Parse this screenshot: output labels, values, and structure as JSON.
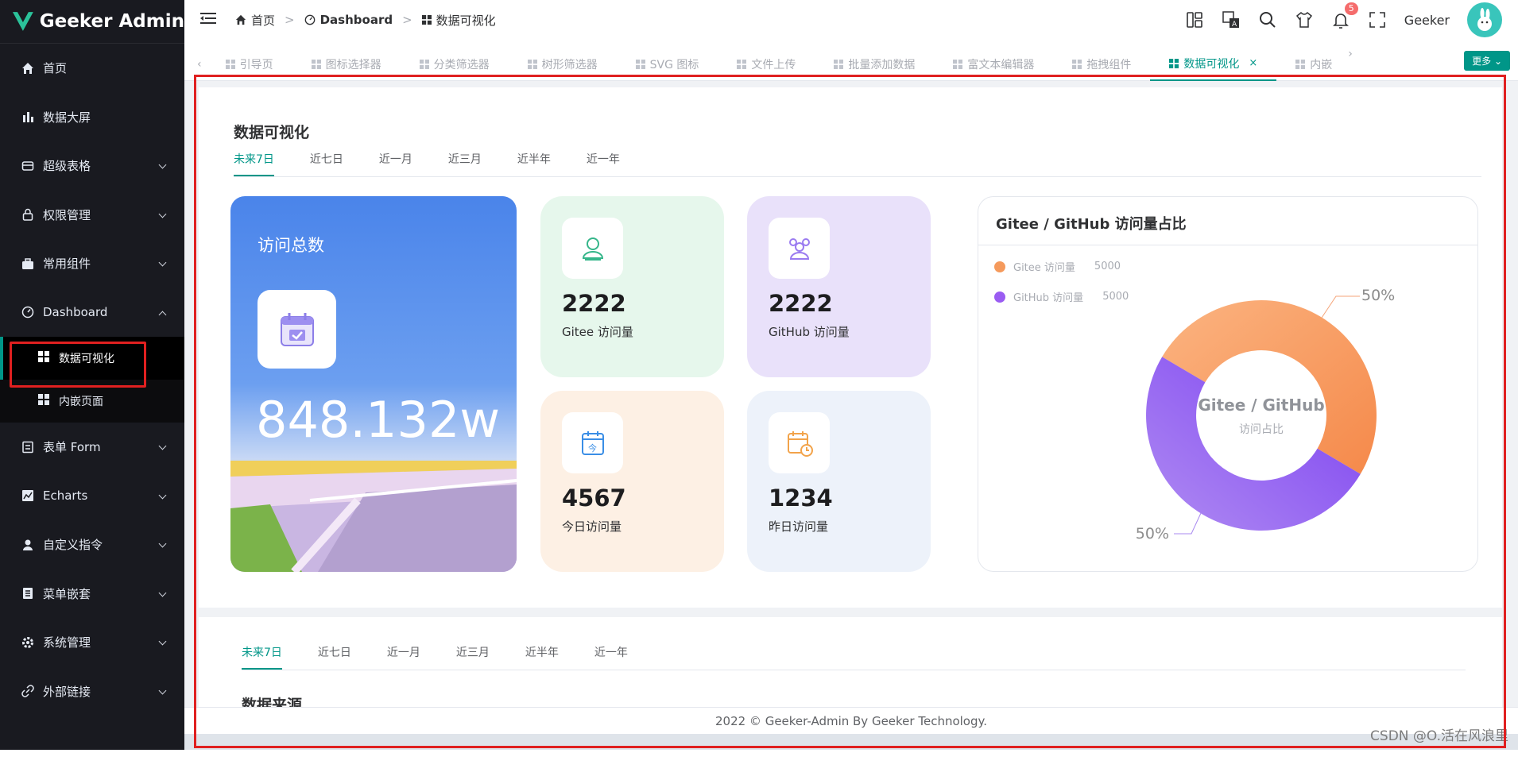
{
  "app": {
    "title": "Geeker Admin"
  },
  "sidebar": {
    "items": [
      {
        "label": "首页",
        "icon": "home-icon",
        "expandable": false
      },
      {
        "label": "数据大屏",
        "icon": "bar-chart-icon",
        "expandable": false
      },
      {
        "label": "超级表格",
        "icon": "table-icon",
        "expandable": true
      },
      {
        "label": "权限管理",
        "icon": "lock-icon",
        "expandable": true
      },
      {
        "label": "常用组件",
        "icon": "briefcase-icon",
        "expandable": true
      },
      {
        "label": "Dashboard",
        "icon": "dashboard-icon",
        "expandable": true,
        "expanded": true
      }
    ],
    "sub_items": [
      {
        "label": "数据可视化",
        "active": true
      },
      {
        "label": "内嵌页面",
        "active": false
      }
    ],
    "items_after": [
      {
        "label": "表单 Form",
        "icon": "form-icon"
      },
      {
        "label": "Echarts",
        "icon": "chart-line-icon"
      },
      {
        "label": "自定义指令",
        "icon": "user-icon"
      },
      {
        "label": "菜单嵌套",
        "icon": "list-icon"
      },
      {
        "label": "系统管理",
        "icon": "gear-icon"
      },
      {
        "label": "外部链接",
        "icon": "link-icon"
      }
    ]
  },
  "header": {
    "breadcrumb": [
      "首页",
      "Dashboard",
      "数据可视化"
    ],
    "user": "Geeker",
    "notifications": "5"
  },
  "tabs": {
    "items": [
      "引导页",
      "图标选择器",
      "分类筛选器",
      "树形筛选器",
      "SVG 图标",
      "文件上传",
      "批量添加数据",
      "富文本编辑器",
      "拖拽组件",
      "数据可视化",
      "内嵌"
    ],
    "active_index": 9,
    "more": "更多"
  },
  "panel": {
    "title": "数据可视化",
    "period_tabs": [
      "未来7日",
      "近七日",
      "近一月",
      "近三月",
      "近半年",
      "近一年"
    ],
    "visit_total": {
      "label": "访问总数",
      "value": "848.132w"
    },
    "stats": [
      {
        "value": "2222",
        "label": "Gitee 访问量",
        "bg": "#e6f7ec",
        "icon": "user-icon",
        "icon_color": "#35b68a"
      },
      {
        "value": "2222",
        "label": "GitHub 访问量",
        "bg": "#e9e1fa",
        "icon": "group-icon",
        "icon_color": "#9a7bf0"
      },
      {
        "value": "4567",
        "label": "今日访问量",
        "bg": "#fdf0e4",
        "icon": "calendar-today-icon",
        "icon_color": "#3a8ee6"
      },
      {
        "value": "1234",
        "label": "昨日访问量",
        "bg": "#edf2fa",
        "icon": "calendar-clock-icon",
        "icon_color": "#f2a34a"
      }
    ],
    "pie": {
      "title": "Gitee / GitHub 访问量占比",
      "legend": [
        {
          "name": "Gitee 访问量",
          "value": "5000",
          "color": "#f59a5c"
        },
        {
          "name": "GitHub 访问量",
          "value": "5000",
          "color": "#9a5cf2"
        }
      ],
      "center_title": "Gitee / GitHub",
      "center_sub": "访问占比",
      "labels": [
        "50%",
        "50%"
      ]
    }
  },
  "panel2": {
    "period_tabs": [
      "未来7日",
      "近七日",
      "近一月",
      "近三月",
      "近半年",
      "近一年"
    ],
    "title": "数据来源"
  },
  "footer": "2022 © Geeker-Admin By Geeker Technology.",
  "watermark": "CSDN @O.活在风浪里",
  "chart_data": {
    "type": "pie",
    "title": "Gitee / GitHub 访问量占比",
    "categories": [
      "Gitee 访问量",
      "GitHub 访问量"
    ],
    "values": [
      5000,
      5000
    ],
    "labels": [
      "50%",
      "50%"
    ]
  }
}
